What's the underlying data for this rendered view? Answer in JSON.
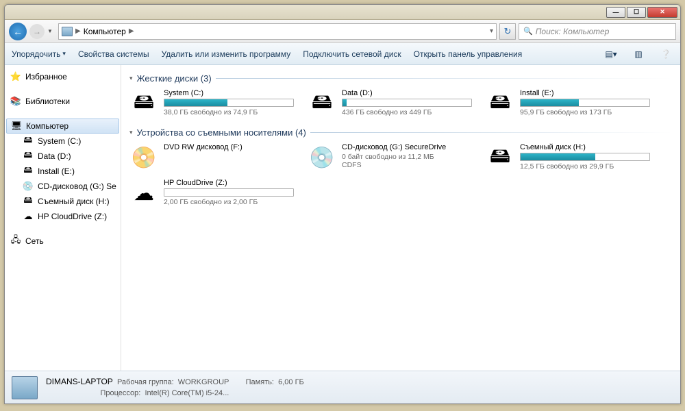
{
  "titlebar": {
    "min": "—",
    "max": "☐",
    "close": "✕"
  },
  "nav": {
    "breadcrumb": "Компьютер",
    "search_placeholder": "Поиск: Компьютер"
  },
  "toolbar": {
    "organize": "Упорядочить",
    "properties": "Свойства системы",
    "uninstall": "Удалить или изменить программу",
    "mapdrive": "Подключить сетевой диск",
    "controlpanel": "Открыть панель управления"
  },
  "sidebar": {
    "favorites": "Избранное",
    "libraries": "Библиотеки",
    "computer": "Компьютер",
    "drives": [
      {
        "label": "System (C:)"
      },
      {
        "label": "Data (D:)"
      },
      {
        "label": "Install (E:)"
      },
      {
        "label": "CD-дисковод (G:) Se"
      },
      {
        "label": "Съемный диск (H:)"
      },
      {
        "label": "HP CloudDrive (Z:)"
      }
    ],
    "network": "Сеть"
  },
  "groups": {
    "hdd": {
      "title": "Жесткие диски (3)"
    },
    "removable": {
      "title": "Устройства со съемными носителями (4)"
    }
  },
  "hdd": [
    {
      "name": "System (C:)",
      "stat": "38,0 ГБ свободно из 74,9 ГБ",
      "fill": 49
    },
    {
      "name": "Data (D:)",
      "stat": "436 ГБ свободно из 449 ГБ",
      "fill": 3
    },
    {
      "name": "Install (E:)",
      "stat": "95,9 ГБ свободно из 173 ГБ",
      "fill": 45
    }
  ],
  "removable": [
    {
      "name": "DVD RW дисковод (F:)",
      "stat": "",
      "fill": null,
      "icon": "dvd"
    },
    {
      "name": "CD-дисковод (G:) SecureDrive",
      "stat": "0 байт свободно из 11,2 МБ",
      "stat2": "CDFS",
      "fill": null,
      "icon": "cd"
    },
    {
      "name": "Съемный диск (H:)",
      "stat": "12,5 ГБ свободно из 29,9 ГБ",
      "fill": 58,
      "icon": "usb"
    },
    {
      "name": "HP CloudDrive (Z:)",
      "stat": "2,00 ГБ свободно из 2,00 ГБ",
      "fill": 0,
      "icon": "cloud"
    }
  ],
  "status": {
    "name": "DIMANS-LAPTOP",
    "workgroup_label": "Рабочая группа:",
    "workgroup": "WORKGROUP",
    "cpu_label": "Процессор:",
    "cpu": "Intel(R) Core(TM) i5-24...",
    "mem_label": "Память:",
    "mem": "6,00 ГБ"
  }
}
